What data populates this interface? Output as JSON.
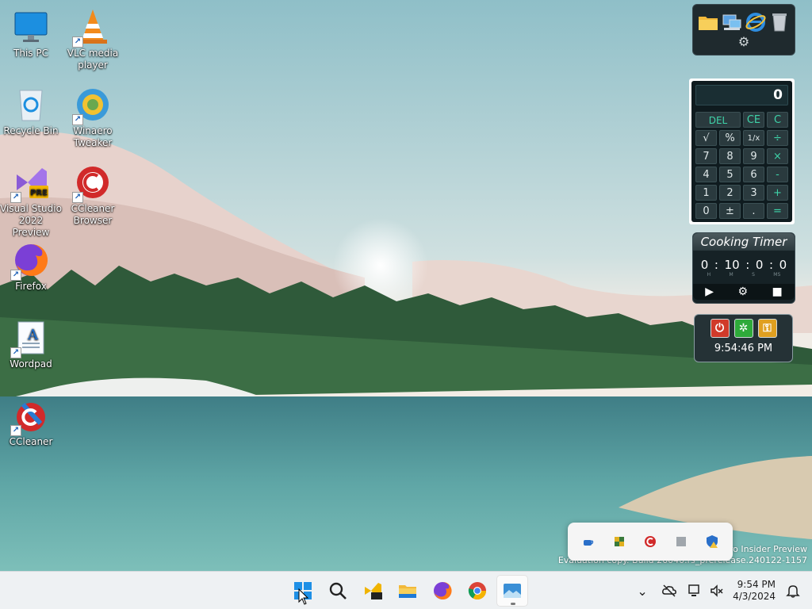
{
  "desktop_icons": [
    {
      "label_lines": [
        "This PC"
      ],
      "icon": "monitor-icon"
    },
    {
      "label_lines": [
        "VLC media",
        "player"
      ],
      "icon": "vlc-cone-icon"
    },
    {
      "label_lines": [
        "Recycle Bin"
      ],
      "icon": "recycle-bin-icon"
    },
    {
      "label_lines": [
        "Winaero",
        "Tweaker"
      ],
      "icon": "winaero-tweaker-icon"
    },
    {
      "label_lines": [
        "Visual Studio",
        "2022 Preview"
      ],
      "icon": "visual-studio-icon",
      "badge": "PRE"
    },
    {
      "label_lines": [
        "CCleaner",
        "Browser"
      ],
      "icon": "ccleaner-browser-icon"
    },
    {
      "label_lines": [
        "Firefox"
      ],
      "icon": "firefox-icon"
    },
    {
      "label_lines": [
        "Wordpad"
      ],
      "icon": "wordpad-icon"
    },
    {
      "label_lines": [
        "CCleaner"
      ],
      "icon": "ccleaner-icon"
    }
  ],
  "launcher_gadget": {
    "icons": [
      "folder-icon",
      "network-computer-icon",
      "internet-explorer-icon",
      "recycle-bin-icon"
    ],
    "settings_icon": "gear-icon",
    "gear_glyph": "⚙"
  },
  "calculator_gadget": {
    "display": "0",
    "keys": [
      {
        "label": "DEL",
        "kind": "wide"
      },
      {
        "label": "CE",
        "kind": "op"
      },
      {
        "label": "C",
        "kind": "op"
      },
      {
        "label": "√",
        "kind": "num"
      },
      {
        "label": "%",
        "kind": "num"
      },
      {
        "label": "1/x",
        "kind": "small"
      },
      {
        "label": "÷",
        "kind": "op"
      },
      {
        "label": "7",
        "kind": "num"
      },
      {
        "label": "8",
        "kind": "num"
      },
      {
        "label": "9",
        "kind": "num"
      },
      {
        "label": "×",
        "kind": "op"
      },
      {
        "label": "4",
        "kind": "num"
      },
      {
        "label": "5",
        "kind": "num"
      },
      {
        "label": "6",
        "kind": "num"
      },
      {
        "label": "-",
        "kind": "op"
      },
      {
        "label": "1",
        "kind": "num"
      },
      {
        "label": "2",
        "kind": "num"
      },
      {
        "label": "3",
        "kind": "num"
      },
      {
        "label": "+",
        "kind": "op"
      },
      {
        "label": "0",
        "kind": "num"
      },
      {
        "label": "±",
        "kind": "num"
      },
      {
        "label": ".",
        "kind": "num"
      },
      {
        "label": "=",
        "kind": "op"
      }
    ]
  },
  "cooking_timer": {
    "title": "Cooking Timer",
    "hours": "0",
    "minutes": "10",
    "seconds": "0",
    "ms": "0",
    "separator": ":",
    "units": [
      "H",
      "M",
      "S",
      "MS"
    ],
    "play_glyph": "▶",
    "settings_glyph": "⚙",
    "stop_glyph": "■"
  },
  "power_gadget": {
    "buttons": [
      {
        "icon": "shutdown-icon",
        "color": "#d03a2a",
        "glyph": "⏻"
      },
      {
        "icon": "restart-icon",
        "color": "#2eaa3a",
        "glyph": "✲"
      },
      {
        "icon": "lock-key-icon",
        "color": "#e0a020",
        "glyph": "⚿"
      }
    ],
    "time": "9:54:46 PM"
  },
  "tray_flyout_icons": [
    "coffee-cup-icon",
    "color-grid-icon",
    "ccleaner-tray-icon",
    "gray-square-icon",
    "security-warning-icon"
  ],
  "watermark": {
    "line1": "Pro Insider Preview",
    "line2": "Evaluation copy. Build 26040.rs_prerelease.240122-1157"
  },
  "taskbar": {
    "apps": [
      "windows-start-icon",
      "search-icon",
      "visual-studio-preview-icon",
      "file-explorer-icon",
      "firefox-icon",
      "chrome-icon",
      "photos-icon"
    ],
    "active_index": 6,
    "tray": {
      "overflow_glyph": "⌄",
      "icons": [
        "onedrive-off-icon",
        "network-icon",
        "volume-mute-icon"
      ],
      "time": "9:54 PM",
      "date": "4/3/2024",
      "notification_icon": "bell-icon"
    }
  },
  "colors": {
    "taskbar_bg": "#eef1f3",
    "accent": "#0078d4",
    "gadget_bg": "#1f2a2e"
  }
}
